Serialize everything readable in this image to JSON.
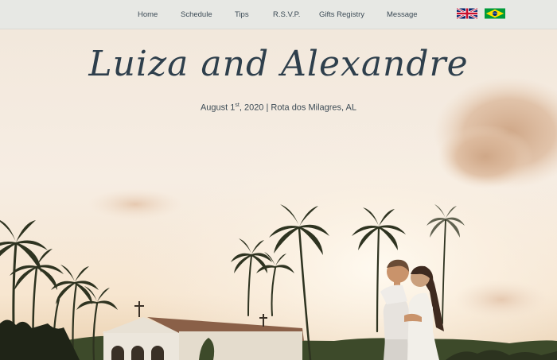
{
  "nav": {
    "items": [
      {
        "label": "Home"
      },
      {
        "label": "Schedule"
      },
      {
        "label": "Tips"
      },
      {
        "label": "R.S.V.P."
      },
      {
        "label": "Gifts Registry"
      },
      {
        "label": "Message"
      }
    ]
  },
  "languages": {
    "english": "English (UK flag)",
    "portuguese": "Portuguese (Brazil flag)"
  },
  "hero": {
    "title": "Luiza and Alexandre",
    "date_main": "August 1",
    "date_suffix": "st",
    "date_rest": ", 2020 | Rota dos Milagres, AL"
  }
}
